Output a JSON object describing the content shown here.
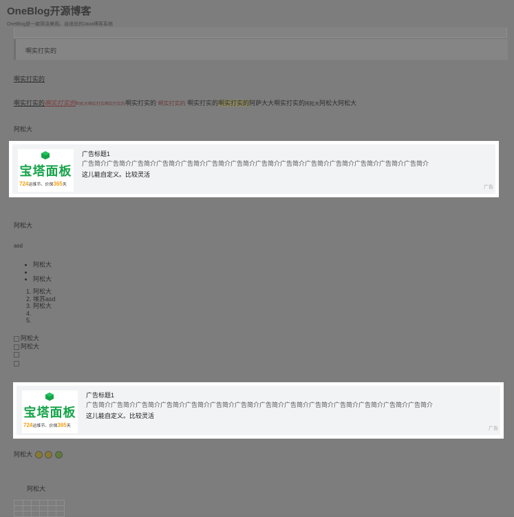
{
  "site": {
    "title": "OneBlog开源博客",
    "description": "OneBlog是一款简洁美观、自适应的Java博客系统"
  },
  "content": {
    "quote": "啊实打实的",
    "link_line": "啊实打实的",
    "mixed": {
      "a": "啊实打实的",
      "b": "啊实打实的",
      "c": "阿松大啊实打实",
      "d": "啊实打实的",
      "e": "啊实打实的",
      "f": "啊实打实的",
      "g": "啊实打实的",
      "h": "啊实打实的",
      "i": "阿萨大大啊实打实的",
      "j": "阿松大",
      "k": "阿松大阿松大"
    },
    "line_asd1": "阿松大",
    "line_asd2": "阿松大",
    "line_asd_small": "asd",
    "bullets": [
      "阿松大",
      "",
      "阿松大"
    ],
    "ordered": [
      "阿松大",
      "埃苏asd",
      "阿松大",
      "",
      ""
    ],
    "checks": [
      "阿松大",
      "阿松大",
      "",
      ""
    ],
    "emoji_line": "阿松大",
    "indented_line": "阿松大"
  },
  "ads": [
    {
      "title": "广告标题1",
      "desc": "广告简介广告简介广告简介广告简介广告简介广告简介广告简介广告简介广告简介广告简介广告简介广告简介广告简介广告简介",
      "extra": "这儿能自定义。比较灵活",
      "tag": "广告",
      "logo_text": "宝塔面板",
      "logo_sub_prefix": "724",
      "logo_sub_mid": "运维节、价保",
      "logo_sub_num": "365",
      "logo_sub_suffix": "天"
    },
    {
      "title": "广告标题1",
      "desc": "广告简介广告简介广告简介广告简介广告简介广告简介广告简介广告简介广告简介广告简介广告简介广告简介广告简介广告简介",
      "extra": "这儿能自定义。比较灵活",
      "tag": "广告",
      "logo_text": "宝塔面板",
      "logo_sub_prefix": "724",
      "logo_sub_mid": "运维节、价保",
      "logo_sub_num": "365",
      "logo_sub_suffix": "天"
    }
  ],
  "colors": {
    "overlay": "#7b7b7b",
    "ad_bg": "#f2f3f5",
    "logo_green": "#16a34a",
    "logo_orange": "#f59e0b"
  }
}
